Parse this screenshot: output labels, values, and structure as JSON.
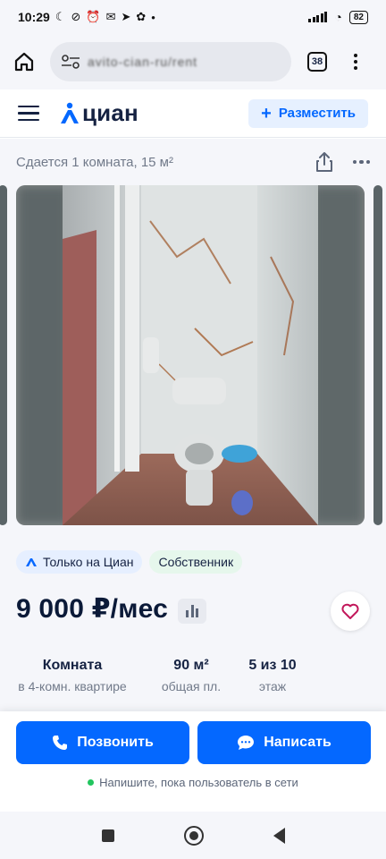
{
  "status_bar": {
    "time": "10:29",
    "battery": "82"
  },
  "browser": {
    "url": "avito-cian-ru/rent",
    "tabs_count": "38"
  },
  "header": {
    "logo": "циан",
    "post_button": "Разместить"
  },
  "listing": {
    "subtitle": "Сдается 1 комната, 15 м²",
    "badges": {
      "exclusive": "Только на Циан",
      "owner": "Собственник"
    },
    "price": "9 000 ₽/мес",
    "facts": [
      {
        "value": "Комната",
        "label": "в 4-комн. квартире"
      },
      {
        "value": "90 м²",
        "label": "общая пл."
      },
      {
        "value": "5 из 10",
        "label": "этаж"
      }
    ]
  },
  "actions": {
    "call": "Позвонить",
    "message": "Написать",
    "online_note": "Напишите, пока пользователь в сети"
  },
  "colors": {
    "brand_blue": "#0468ff",
    "dark_text": "#152242",
    "online_green": "#22c55e"
  }
}
